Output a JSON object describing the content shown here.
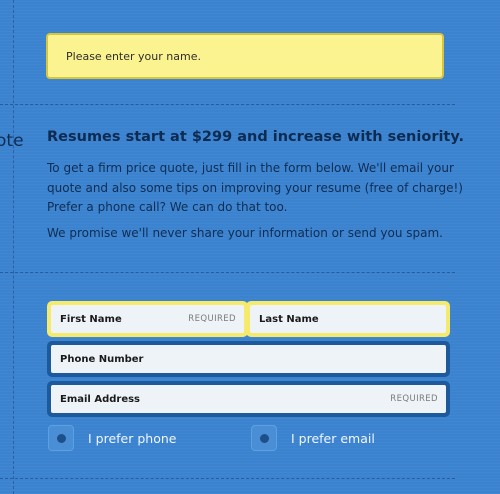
{
  "alert": {
    "message": "Please enter your name."
  },
  "side_label": "ote",
  "intro": {
    "heading": "Resumes start at $299 and increase with seniority.",
    "paragraph1": "To get a firm price quote, just fill in the form below. We'll email your quote and also some tips on improving your resume (free of charge!) Prefer a phone call? We can do that too.",
    "paragraph2": "We promise we'll never share your information or send you spam."
  },
  "form": {
    "first_name": {
      "label": "First Name",
      "required": "REQUIRED"
    },
    "last_name": {
      "label": "Last Name"
    },
    "phone": {
      "label": "Phone Number"
    },
    "email": {
      "label": "Email Address",
      "required": "REQUIRED"
    },
    "prefer_phone": "I prefer phone",
    "prefer_email": "I prefer email"
  },
  "colors": {
    "background": "#3c83cf",
    "alert_bg": "#fbf38f",
    "error_border": "#f5ea6b",
    "field_border": "#1c5a9b"
  }
}
